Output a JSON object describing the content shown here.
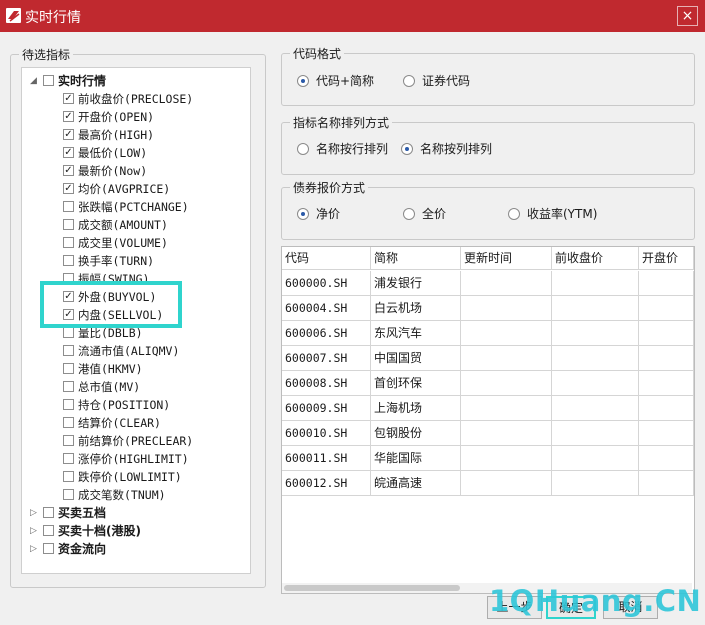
{
  "window": {
    "title": "实时行情",
    "close_glyph": "×",
    "title_icon": "app-logo-icon",
    "accent": "#c0292f"
  },
  "indicator_panel": {
    "title": "待选指标",
    "tree": {
      "groups": [
        {
          "label": "实时行情",
          "expanded": true,
          "items": [
            {
              "label": "前收盘价(PRECLOSE)",
              "checked": true
            },
            {
              "label": "开盘价(OPEN)",
              "checked": true
            },
            {
              "label": "最高价(HIGH)",
              "checked": true
            },
            {
              "label": "最低价(LOW)",
              "checked": true
            },
            {
              "label": "最新价(Now)",
              "checked": true
            },
            {
              "label": "均价(AVGPRICE)",
              "checked": true
            },
            {
              "label": "张跌幅(PCTCHANGE)",
              "checked": false
            },
            {
              "label": "成交额(AMOUNT)",
              "checked": false
            },
            {
              "label": "成交里(VOLUME)",
              "checked": false
            },
            {
              "label": "换手率(TURN)",
              "checked": false
            },
            {
              "label": "振幅(SWING)",
              "checked": false
            },
            {
              "label": "外盘(BUYVOL)",
              "checked": true
            },
            {
              "label": "内盘(SELLVOL)",
              "checked": true
            },
            {
              "label": "量比(DBLB)",
              "checked": false
            },
            {
              "label": "流通市值(ALIQMV)",
              "checked": false
            },
            {
              "label": "港值(HKMV)",
              "checked": false
            },
            {
              "label": "总市值(MV)",
              "checked": false
            },
            {
              "label": "持仓(POSITION)",
              "checked": false
            },
            {
              "label": "结算价(CLEAR)",
              "checked": false
            },
            {
              "label": "前结算价(PRECLEAR)",
              "checked": false
            },
            {
              "label": "涨停价(HIGHLIMIT)",
              "checked": false
            },
            {
              "label": "跌停价(LOWLIMIT)",
              "checked": false
            },
            {
              "label": "成交笔数(TNUM)",
              "checked": false
            }
          ]
        },
        {
          "label": "买卖五档",
          "expanded": false
        },
        {
          "label": "买卖十档(港股)",
          "expanded": false
        },
        {
          "label": "资金流向",
          "expanded": false
        }
      ]
    }
  },
  "code_format": {
    "title": "代码格式",
    "options": [
      "代码+简称",
      "证券代码"
    ],
    "selected": 0
  },
  "sort_mode": {
    "title": "指标名称排列方式",
    "options": [
      "名称按行排列",
      "名称按列排列"
    ],
    "selected": 1
  },
  "bond_quote": {
    "title": "债券报价方式",
    "options": [
      "净价",
      "全价",
      "收益率(YTM)"
    ],
    "selected": 0
  },
  "preview_table": {
    "columns": [
      "代码",
      "简称",
      "更新时间",
      "前收盘价",
      "开盘价"
    ],
    "rows": [
      [
        "600000.SH",
        "浦发银行",
        "",
        "",
        ""
      ],
      [
        "600004.SH",
        "白云机场",
        "",
        "",
        ""
      ],
      [
        "600006.SH",
        "东风汽车",
        "",
        "",
        ""
      ],
      [
        "600007.SH",
        "中国国贸",
        "",
        "",
        ""
      ],
      [
        "600008.SH",
        "首创环保",
        "",
        "",
        ""
      ],
      [
        "600009.SH",
        "上海机场",
        "",
        "",
        ""
      ],
      [
        "600010.SH",
        "包钢股份",
        "",
        "",
        ""
      ],
      [
        "600011.SH",
        "华能国际",
        "",
        "",
        ""
      ],
      [
        "600012.SH",
        "皖通高速",
        "",
        "",
        ""
      ]
    ]
  },
  "buttons": {
    "prev": "上一步",
    "ok": "确定",
    "cancel": "取消"
  },
  "watermark": "1QHuang.CN",
  "highlight_color": "#2fd4cd"
}
